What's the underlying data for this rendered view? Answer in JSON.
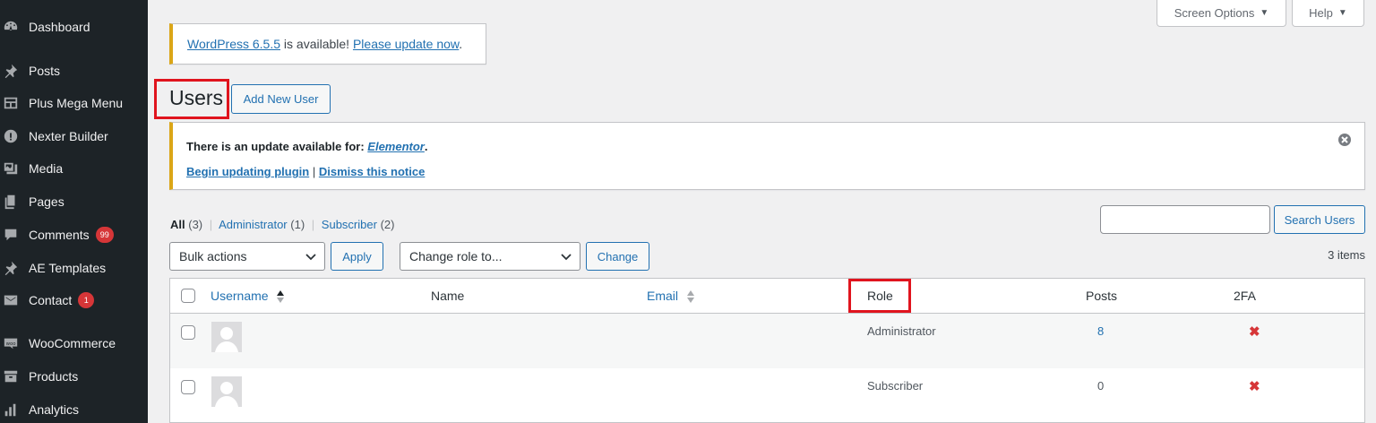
{
  "sidebar": {
    "items": [
      {
        "label": "Dashboard",
        "icon": "dashboard-icon"
      },
      {
        "label": "Posts",
        "icon": "pin-icon"
      },
      {
        "label": "Plus Mega Menu",
        "icon": "menu-grid-icon"
      },
      {
        "label": "Nexter Builder",
        "icon": "info-circle-icon"
      },
      {
        "label": "Media",
        "icon": "media-icon"
      },
      {
        "label": "Pages",
        "icon": "pages-icon"
      },
      {
        "label": "Comments",
        "icon": "comment-icon",
        "badge": "99"
      },
      {
        "label": "AE Templates",
        "icon": "pin-icon"
      },
      {
        "label": "Contact",
        "icon": "mail-icon",
        "badge": "1"
      },
      {
        "label": "WooCommerce",
        "icon": "woo-icon"
      },
      {
        "label": "Products",
        "icon": "archive-icon"
      },
      {
        "label": "Analytics",
        "icon": "bar-chart-icon"
      }
    ]
  },
  "topbar": {
    "screen_options": "Screen Options",
    "help": "Help"
  },
  "update_nag": {
    "version_link": "WordPress 6.5.5",
    "middle": " is available! ",
    "update_link": "Please update now",
    "end": "."
  },
  "header": {
    "title": "Users",
    "add_new": "Add New User"
  },
  "plugin_notice": {
    "prefix": "There is an update available for: ",
    "plugin": "Elementor",
    "suffix": ".",
    "begin_link": "Begin updating plugin",
    "separator": "|",
    "dismiss_link": "Dismiss this notice"
  },
  "filters": {
    "all_label": "All",
    "all_count": "(3)",
    "admin_label": "Administrator",
    "admin_count": "(1)",
    "subscriber_label": "Subscriber",
    "subscriber_count": "(2)",
    "sep": "|"
  },
  "search": {
    "value": "",
    "button": "Search Users"
  },
  "actions": {
    "bulk_selected": "Bulk actions",
    "apply": "Apply",
    "role_selected": "Change role to...",
    "change": "Change",
    "items_count": "3 items"
  },
  "table": {
    "columns": {
      "username": "Username",
      "name": "Name",
      "email": "Email",
      "role": "Role",
      "posts": "Posts",
      "twofa": "2FA"
    },
    "rows": [
      {
        "role": "Administrator",
        "posts": "8",
        "twofa": "✖"
      },
      {
        "role": "Subscriber",
        "posts": "0",
        "twofa": "✖"
      }
    ]
  },
  "colors": {
    "sidebar_bg": "#1d2327",
    "accent": "#2271b1",
    "notice_warning": "#dba617",
    "highlight_box": "#e0141e",
    "badge": "#d63638",
    "twofa_off": "#d63638"
  }
}
